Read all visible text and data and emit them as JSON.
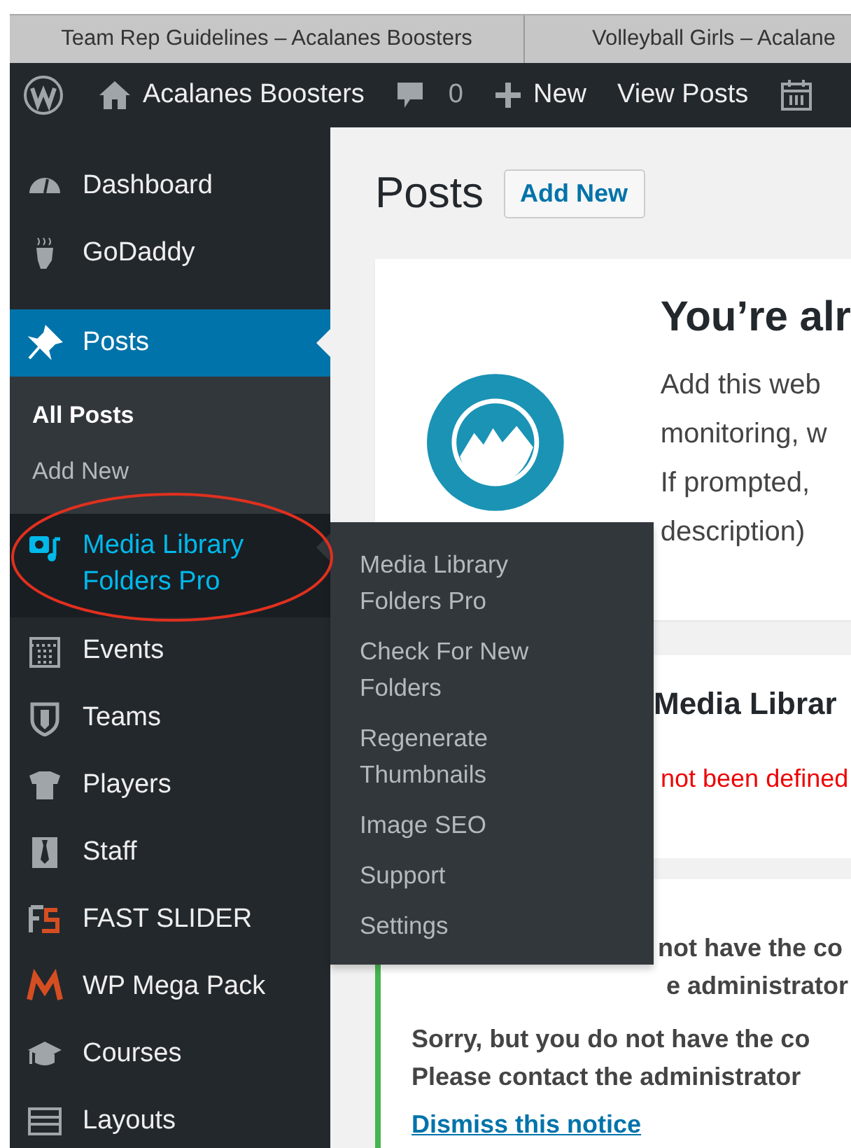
{
  "browser_tabs": [
    {
      "title": "Team Rep Guidelines – Acalanes Boosters"
    },
    {
      "title": "Volleyball Girls – Acalane"
    }
  ],
  "admin_bar": {
    "site_name": "Acalanes Boosters",
    "comments": "0",
    "new": "New",
    "view": "View Posts"
  },
  "sidebar": {
    "items": [
      {
        "label": "Dashboard",
        "selected": false,
        "hovered": false
      },
      {
        "label": "GoDaddy",
        "selected": false,
        "hovered": false
      },
      {
        "label": "Posts",
        "selected": true,
        "hovered": false,
        "submenu": [
          {
            "label": "All Posts",
            "selected": true
          },
          {
            "label": "Add New",
            "selected": false
          }
        ]
      },
      {
        "label": "Media Library Folders Pro",
        "selected": false,
        "hovered": true,
        "flyout": [
          "Media Library Folders Pro",
          "Check For New Folders",
          "Regenerate Thumbnails",
          "Image SEO",
          "Support",
          "Settings"
        ]
      },
      {
        "label": "Events",
        "selected": false,
        "hovered": false
      },
      {
        "label": "Teams",
        "selected": false,
        "hovered": false
      },
      {
        "label": "Players",
        "selected": false,
        "hovered": false
      },
      {
        "label": "Staff",
        "selected": false,
        "hovered": false
      },
      {
        "label": "FAST SLIDER",
        "selected": false,
        "hovered": false
      },
      {
        "label": "WP Mega Pack",
        "selected": false,
        "hovered": false
      },
      {
        "label": "Courses",
        "selected": false,
        "hovered": false
      },
      {
        "label": "Layouts",
        "selected": false,
        "hovered": false
      }
    ]
  },
  "page": {
    "title": "Posts",
    "add_new": "Add New",
    "notice_1": {
      "heading": "You’re alr",
      "lines": [
        "Add this web",
        "monitoring, w",
        "If prompted,",
        "description)"
      ]
    },
    "notice_2": {
      "heading": "Media Librar",
      "error": "not been defined"
    },
    "notice_3": {
      "hidden_lines": [
        "not have the co",
        "e administrator"
      ],
      "lines": [
        "Sorry, but you do not have the co",
        "Please contact the administrator"
      ],
      "link": "Dismiss this notice"
    }
  }
}
